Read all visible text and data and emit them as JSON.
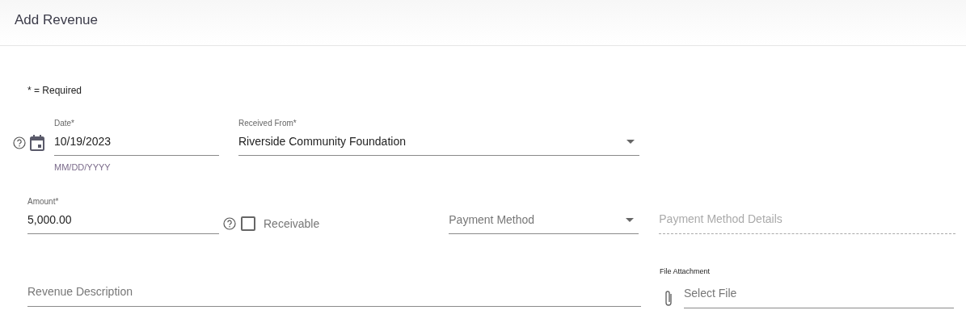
{
  "header": {
    "title": "Add Revenue"
  },
  "required_note": "* = Required",
  "date": {
    "label": "Date*",
    "value": "10/19/2023",
    "hint": "MM/DD/YYYY"
  },
  "received_from": {
    "label": "Received From*",
    "value": "Riverside Community Foundation"
  },
  "amount": {
    "label": "Amount*",
    "value": "5,000.00"
  },
  "receivable": {
    "label": "Receivable",
    "checked": false
  },
  "payment_method": {
    "placeholder": "Payment Method"
  },
  "payment_method_details": {
    "placeholder": "Payment Method Details",
    "disabled": true
  },
  "revenue_description": {
    "placeholder": "Revenue Description"
  },
  "file_attachment": {
    "label": "File Attachment",
    "placeholder": "Select File"
  }
}
